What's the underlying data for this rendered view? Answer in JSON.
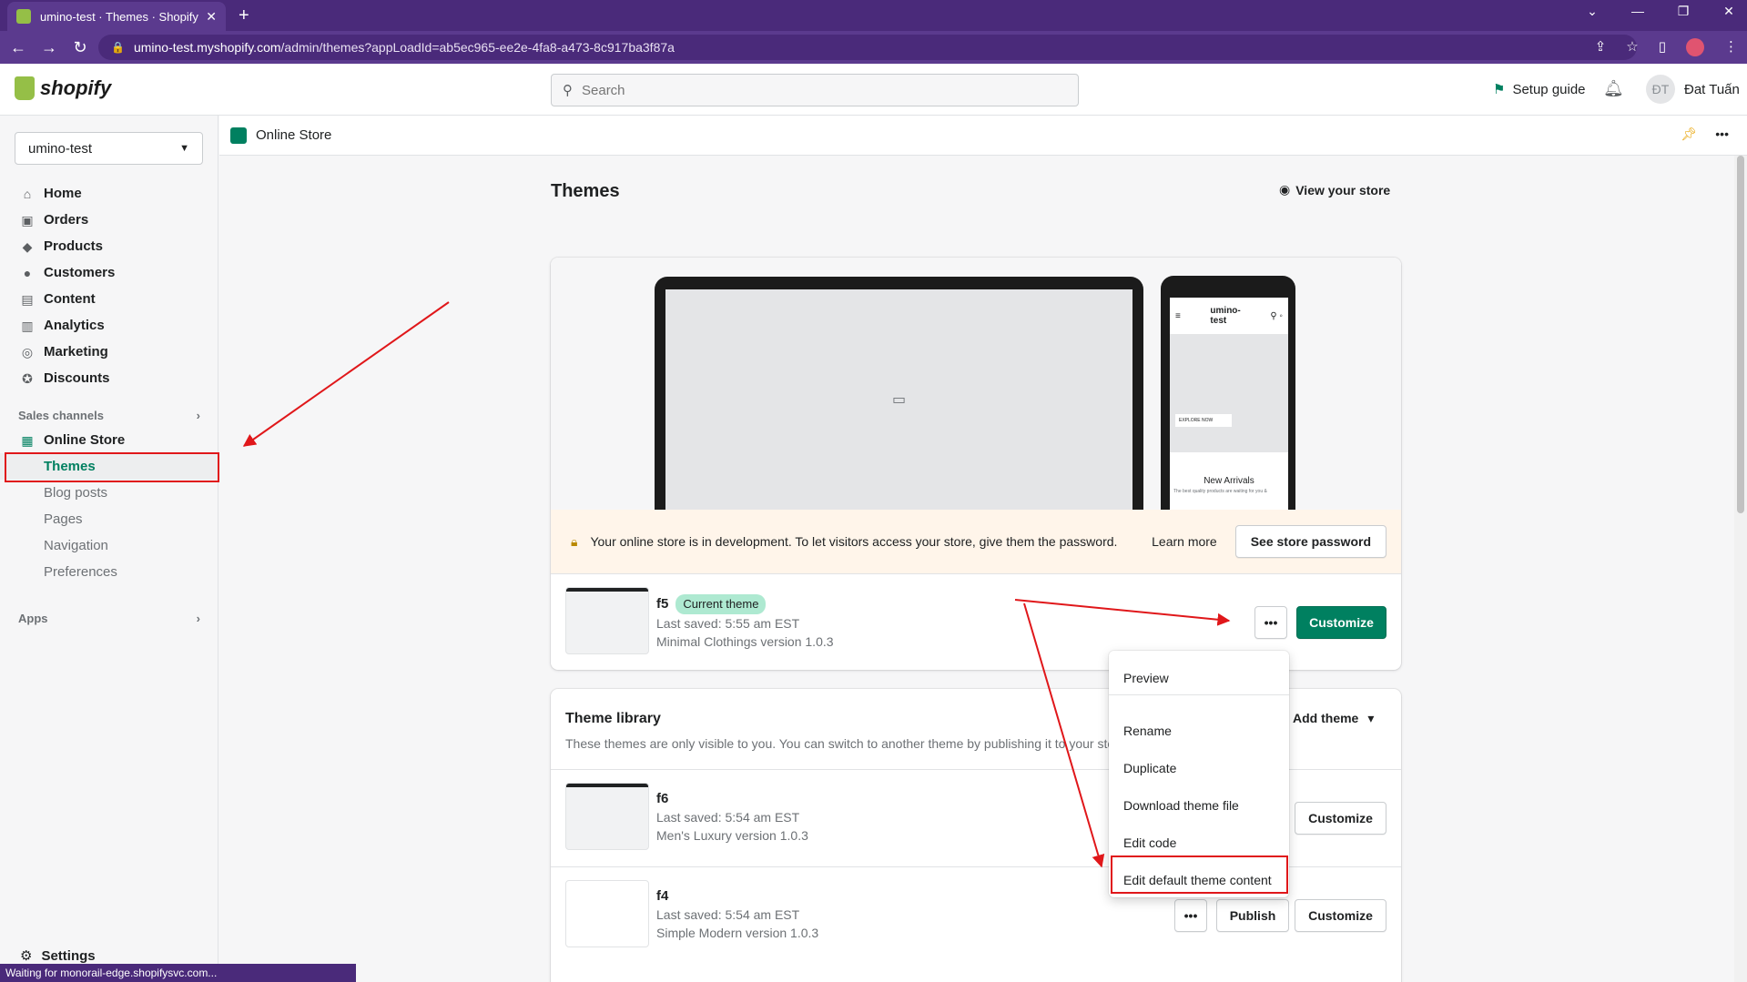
{
  "browser": {
    "tab_title": "umino-test · Themes · Shopify",
    "url_host": "umino-test.myshopify.com",
    "url_path": "/admin/themes?appLoadId=ab5ec965-ee2e-4fa8-a473-8c917ba3f87a",
    "status_text": "Waiting for monorail-edge.shopifysvc.com..."
  },
  "topbar": {
    "logo_text": "shopify",
    "search_placeholder": "Search",
    "setup_guide": "Setup guide",
    "user_initials": "ĐT",
    "user_name": "Đat Tuấn"
  },
  "sidebar": {
    "store_name": "umino-test",
    "items": [
      {
        "label": "Home",
        "icon": "home-icon"
      },
      {
        "label": "Orders",
        "icon": "orders-icon"
      },
      {
        "label": "Products",
        "icon": "tag-icon"
      },
      {
        "label": "Customers",
        "icon": "person-icon"
      },
      {
        "label": "Content",
        "icon": "content-icon"
      },
      {
        "label": "Analytics",
        "icon": "bar-chart-icon"
      },
      {
        "label": "Marketing",
        "icon": "target-icon"
      },
      {
        "label": "Discounts",
        "icon": "discount-icon"
      }
    ],
    "sales_channels_label": "Sales channels",
    "online_store": "Online Store",
    "sub_items": [
      "Themes",
      "Blog posts",
      "Pages",
      "Navigation",
      "Preferences"
    ],
    "apps_label": "Apps",
    "settings": "Settings"
  },
  "breadcrumb": {
    "label": "Online Store"
  },
  "main": {
    "title": "Themes",
    "view_store": "View your store",
    "phone_store_name": "umino-\ntest",
    "phone_button": "EXPLORE NOW",
    "phone_heading": "New Arrivals",
    "phone_sub": "The best quality products are waiting for you &",
    "dev_banner": {
      "message": "Your online store is in development. To let visitors access your store, give them the password.",
      "learn_more": "Learn more",
      "button": "See store password"
    },
    "current_theme": {
      "name": "f5",
      "badge": "Current theme",
      "saved": "Last saved: 5:55 am EST",
      "version": "Minimal Clothings version 1.0.3",
      "customize": "Customize"
    },
    "library": {
      "title": "Theme library",
      "description": "These themes are only visible to you. You can switch to another theme by publishing it to your sto",
      "add_theme": "Add theme",
      "themes": [
        {
          "name": "f6",
          "saved": "Last saved: 5:54 am EST",
          "version": "Men's Luxury version 1.0.3",
          "customize": "Customize"
        },
        {
          "name": "f4",
          "saved": "Last saved: 5:54 am EST",
          "version": "Simple Modern version 1.0.3",
          "customize": "Customize",
          "publish": "Publish"
        }
      ]
    }
  },
  "popover": {
    "items": [
      "Preview",
      "Rename",
      "Duplicate",
      "Download theme file",
      "Edit code",
      "Edit default theme content"
    ]
  },
  "colors": {
    "brand_green": "#008060",
    "browser_purple": "#5b3a8e",
    "annotation_red": "#e0171a"
  }
}
